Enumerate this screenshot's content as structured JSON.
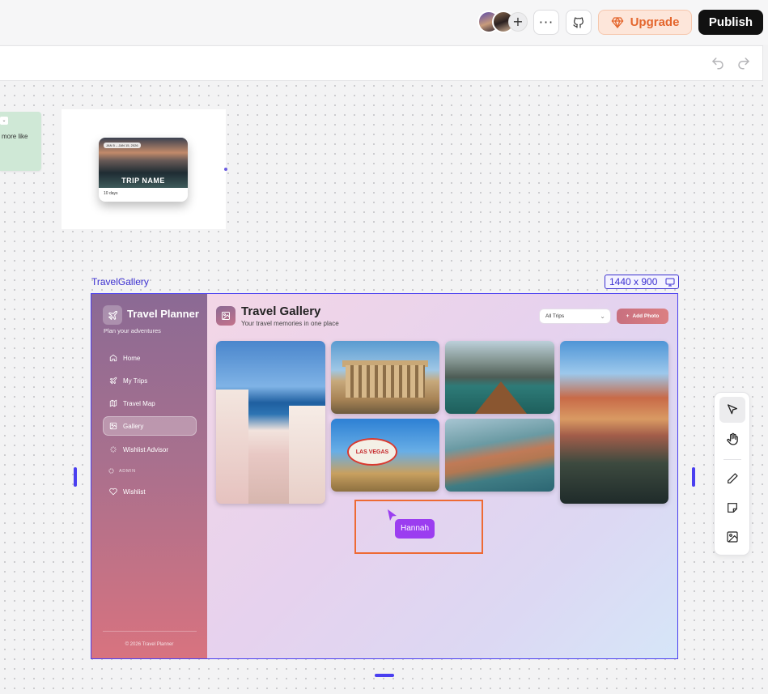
{
  "topbar": {
    "more_label": "···",
    "upgrade_label": "Upgrade",
    "publish_label": "Publish",
    "add_collaborator": "+"
  },
  "canvas": {
    "sticky_text": "more like",
    "trip_card": {
      "date": "JAN 5 – JAN 15, 2026",
      "name": "TRIP NAME",
      "days": "10 days"
    },
    "frame_label": "TravelGallery",
    "frame_size": "1440 x 900",
    "cursor_user": "Hannah"
  },
  "app": {
    "title": "Travel Planner",
    "subtitle": "Plan your adventures",
    "nav": [
      {
        "label": "Home",
        "icon": "home-icon"
      },
      {
        "label": "My Trips",
        "icon": "plane-icon"
      },
      {
        "label": "Travel Map",
        "icon": "map-icon"
      },
      {
        "label": "Gallery",
        "icon": "gallery-icon",
        "active": true
      },
      {
        "label": "Wishlist Advisor",
        "icon": "sparkle-icon"
      },
      {
        "label": "Wishlist",
        "icon": "heart-icon"
      }
    ],
    "section_admin": "ADMIN",
    "footer": "© 2026 Travel Planner",
    "page_title": "Travel Gallery",
    "page_subtitle": "Your travel memories in one place",
    "filter_value": "All Trips",
    "add_photo_label": "Add Photo",
    "vegas_sign": "LAS VEGAS"
  },
  "colors": {
    "accent": "#4a3ff0",
    "upgrade": "#e4662d",
    "highlight": "#ee6a34",
    "cursor": "#9b3df0"
  }
}
